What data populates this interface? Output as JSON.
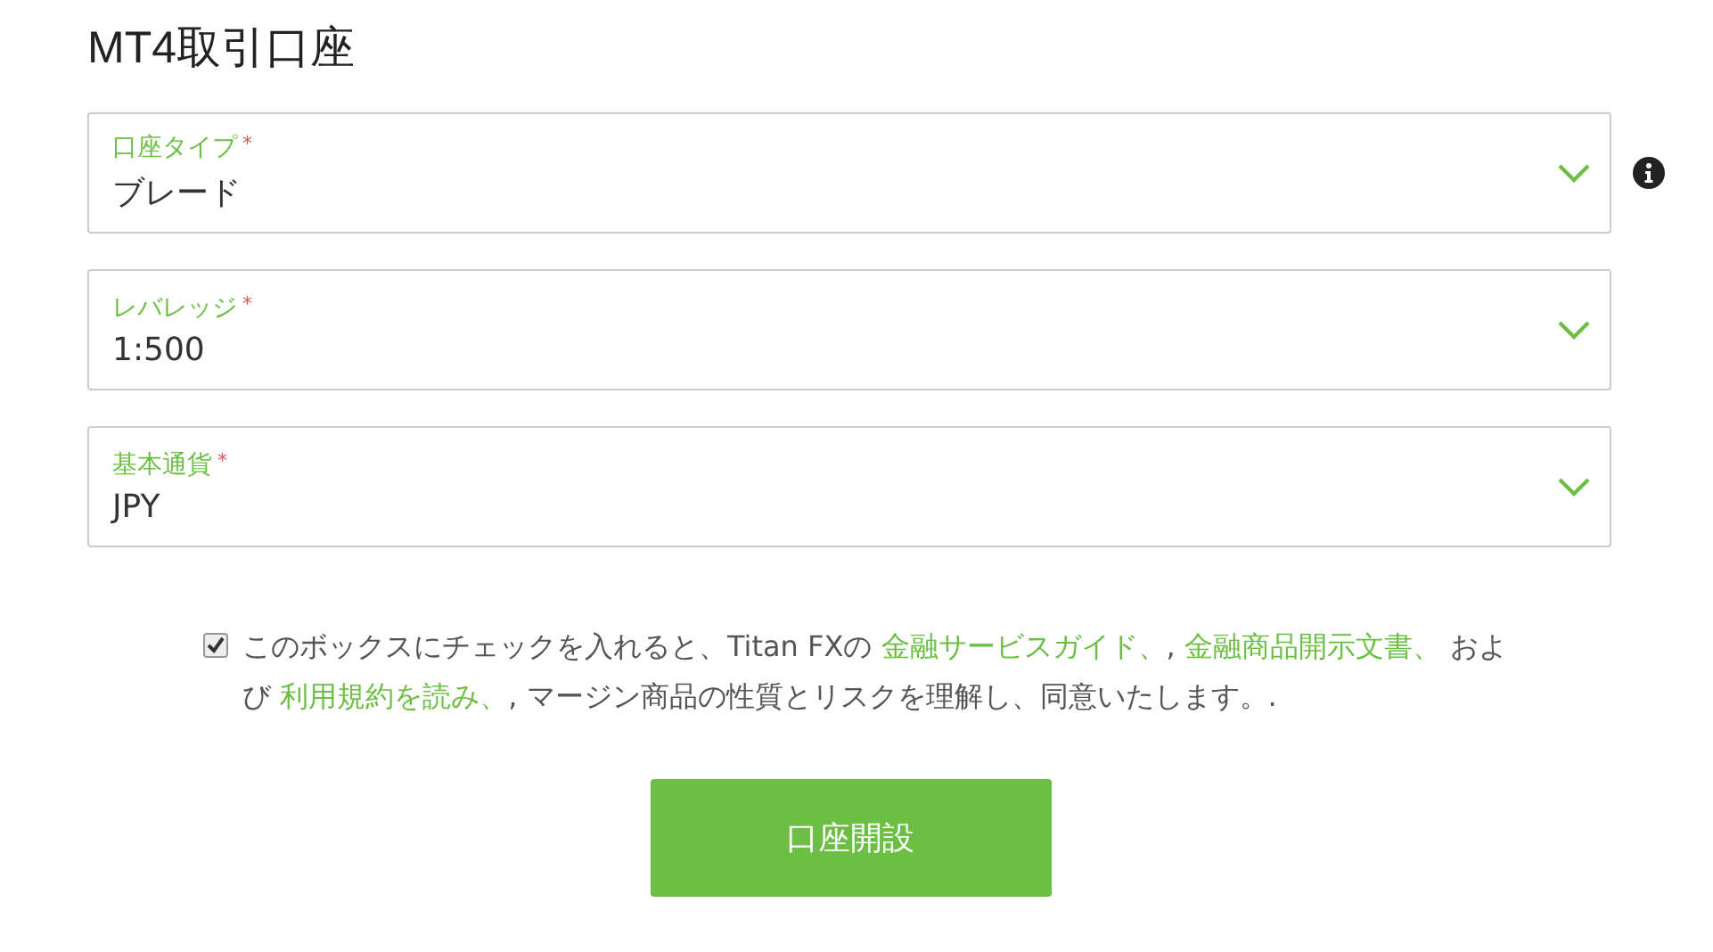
{
  "title": "MT4取引口座",
  "fields": [
    {
      "label": "口座タイプ",
      "required": "*",
      "value": "ブレード",
      "info": true
    },
    {
      "label": "レバレッジ",
      "required": "*",
      "value": "1:500",
      "info": false
    },
    {
      "label": "基本通貨",
      "required": "*",
      "value": "JPY",
      "info": false
    }
  ],
  "agreement": {
    "checked": true,
    "parts": [
      {
        "kind": "text",
        "text": "このボックスにチェックを入れると、Titan FXの "
      },
      {
        "kind": "link",
        "text": "金融サービスガイド、"
      },
      {
        "kind": "text",
        "text": ", "
      },
      {
        "kind": "link",
        "text": "金融商品開示文書、"
      },
      {
        "kind": "text",
        "text": " および "
      },
      {
        "kind": "link",
        "text": "利用規約を読み、"
      },
      {
        "kind": "text",
        "text": ", マージン商品の性質とリスクを理解し、同意いたします。."
      }
    ]
  },
  "submit": "口座開設"
}
